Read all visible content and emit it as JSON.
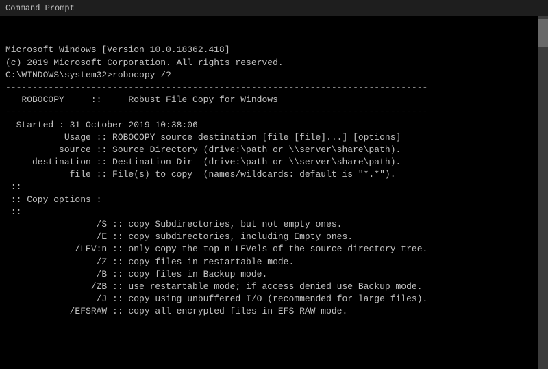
{
  "terminal": {
    "title": "Command Prompt",
    "lines": [
      "Microsoft Windows [Version 10.0.18362.418]",
      "(c) 2019 Microsoft Corporation. All rights reserved.",
      "",
      "C:\\WINDOWS\\system32>robocopy /?",
      "",
      "-------------------------------------------------------------------------------",
      "",
      "   ROBOCOPY     ::     Robust File Copy for Windows",
      "",
      "-------------------------------------------------------------------------------",
      "",
      "  Started : 31 October 2019 10:38:06",
      "           Usage :: ROBOCOPY source destination [file [file]...] [options]",
      "",
      "          source :: Source Directory (drive:\\path or \\\\server\\share\\path).",
      "     destination :: Destination Dir  (drive:\\path or \\\\server\\share\\path).",
      "            file :: File(s) to copy  (names/wildcards: default is \"*.*\").",
      "",
      " ::",
      " :: Copy options :",
      " ::",
      "",
      "                 /S :: copy Subdirectories, but not empty ones.",
      "                 /E :: copy subdirectories, including Empty ones.",
      "             /LEV:n :: only copy the top n LEVels of the source directory tree.",
      "",
      "                 /Z :: copy files in restartable mode.",
      "                 /B :: copy files in Backup mode.",
      "                /ZB :: use restartable mode; if access denied use Backup mode.",
      "                 /J :: copy using unbuffered I/O (recommended for large files).",
      "            /EFSRAW :: copy all encrypted files in EFS RAW mode."
    ]
  }
}
